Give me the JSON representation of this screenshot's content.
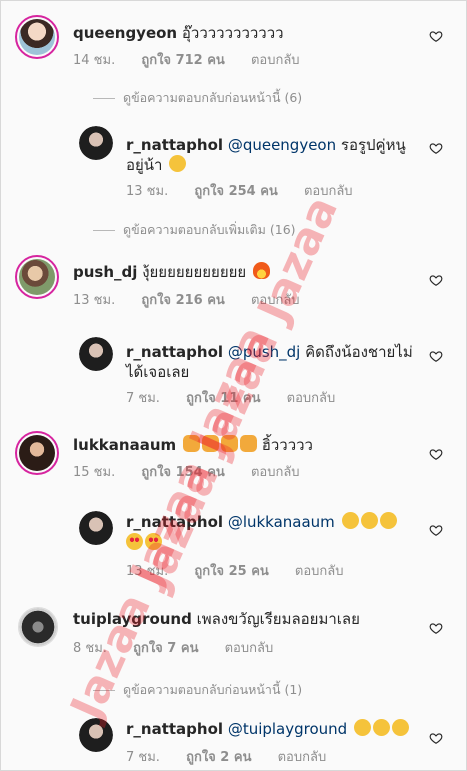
{
  "comments": [
    {
      "username": "queengyeon",
      "mention": "",
      "text": "อุ๊ววววววววววว",
      "time": "14 ชม.",
      "likes": "ถูกใจ 712 คน",
      "reply": "ตอบกลับ"
    },
    {
      "username": "r_nattaphol",
      "mention": "@queengyeon",
      "text": " รอรูปคู่หนู",
      "text2": "อยู่น้า",
      "time": "13 ชม.",
      "likes": "ถูกใจ 254 คน",
      "reply": "ตอบกลับ"
    },
    {
      "username": "push_dj",
      "mention": "",
      "text": "งุ้ยยยยยยยยยยย",
      "time": "13 ชม.",
      "likes": "ถูกใจ 216 คน",
      "reply": "ตอบกลับ"
    },
    {
      "username": "r_nattaphol",
      "mention": "@push_dj",
      "text": " คิดถึงน้องชายไม่",
      "text2": "ได้เจอเลย",
      "time": "7 ชม.",
      "likes": "ถูกใจ 11 คน",
      "reply": "ตอบกลับ"
    },
    {
      "username": "lukkanaaum",
      "mention": "",
      "text": "ฮิ้ววววว",
      "time": "15 ชม.",
      "likes": "ถูกใจ 154 คน",
      "reply": "ตอบกลับ"
    },
    {
      "username": "r_nattaphol",
      "mention": "@lukkanaaum",
      "text": "",
      "time": "13 ชม.",
      "likes": "ถูกใจ 25 คน",
      "reply": "ตอบกลับ"
    },
    {
      "username": "tuiplayground",
      "mention": "",
      "text": "เพลงขวัญเรียมลอยมาเลย",
      "time": "8 ชม.",
      "likes": "ถูกใจ 7 คน",
      "reply": "ตอบกลับ"
    },
    {
      "username": "r_nattaphol",
      "mention": "@tuiplayground",
      "text": "",
      "time": "7 ชม.",
      "likes": "ถูกใจ 2 คน",
      "reply": "ตอบกลับ"
    }
  ],
  "view_more": [
    "ดูข้อความตอบกลับก่อนหน้านี้ (6)",
    "ดูข้อความตอบกลับเพิ่มเติม (16)",
    "ดูข้อความตอบกลับก่อนหน้านี้ (1)"
  ],
  "watermark": [
    "Jazaa Jazaa Jazaa",
    "Jazaa Jazaa Jazaa"
  ],
  "icons": {
    "like": "heart-outline-icon",
    "emoji": "smiling-face-icon"
  },
  "colors": {
    "username": "#262626",
    "mention": "#003569",
    "meta": "#8e8e8e",
    "watermark": "#eb1e28",
    "story_ring": "#d6249f"
  }
}
